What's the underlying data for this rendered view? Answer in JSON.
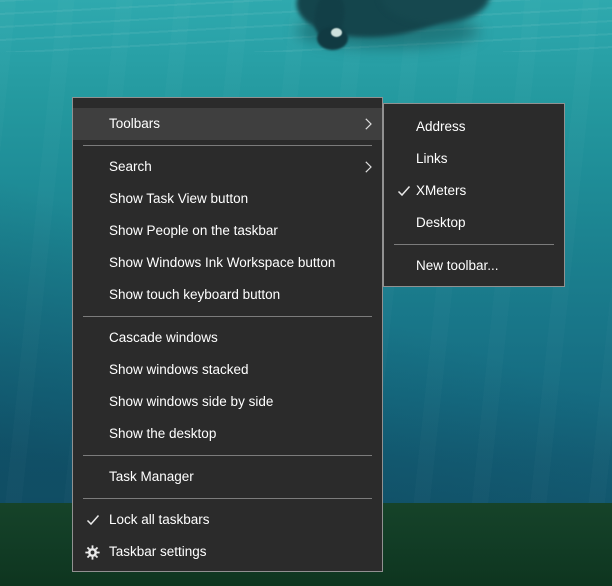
{
  "wallpaper": {
    "colors": {
      "water_top": "#2aa3a9",
      "water_bottom": "#135d74",
      "ground_green": "#123d26",
      "swimmer_silhouette": "#14454c"
    }
  },
  "colors": {
    "menu_background": "#2b2b2b",
    "menu_highlight": "#3f3f3f",
    "menu_border": "#919191",
    "menu_text": "#ffffff",
    "separator": "#7c7c7c"
  },
  "menus": {
    "main": {
      "items": [
        {
          "label": "Toolbars",
          "has_submenu": true,
          "highlighted": true
        },
        {
          "separator": true
        },
        {
          "label": "Search",
          "has_submenu": true
        },
        {
          "label": "Show Task View button"
        },
        {
          "label": "Show People on the taskbar"
        },
        {
          "label": "Show Windows Ink Workspace button"
        },
        {
          "label": "Show touch keyboard button"
        },
        {
          "separator": true
        },
        {
          "label": "Cascade windows"
        },
        {
          "label": "Show windows stacked"
        },
        {
          "label": "Show windows side by side"
        },
        {
          "label": "Show the desktop"
        },
        {
          "separator": true
        },
        {
          "label": "Task Manager"
        },
        {
          "separator": true
        },
        {
          "label": "Lock all taskbars",
          "checked": true,
          "icon": "checkmark-icon"
        },
        {
          "label": "Taskbar settings",
          "icon": "gear-icon"
        }
      ]
    },
    "toolbars_submenu": {
      "items": [
        {
          "label": "Address"
        },
        {
          "label": "Links"
        },
        {
          "label": "XMeters",
          "checked": true,
          "icon": "checkmark-icon"
        },
        {
          "label": "Desktop"
        },
        {
          "separator": true
        },
        {
          "label": "New toolbar..."
        }
      ]
    }
  }
}
